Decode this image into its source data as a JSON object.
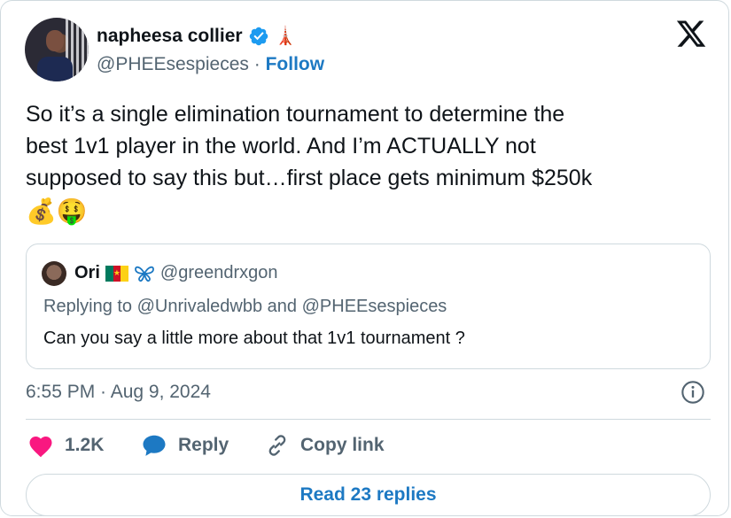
{
  "author": {
    "display_name": "napheesa collier",
    "handle": "@PHEEsespieces",
    "separator": "·",
    "follow_label": "Follow",
    "badge_emoji": "🗼"
  },
  "tweet": {
    "text": "So it’s a single elimination tournament to determine the\nbest 1v1 player in the world. And I’m ACTUALLY not\nsupposed to say this but…first place gets minimum $250k",
    "emojis": "💰🤑",
    "timestamp": "6:55 PM · Aug 9, 2024"
  },
  "quoted_tweet": {
    "display_name": "Ori",
    "handle": "@greendrxgon",
    "replying_prefix": "Replying to",
    "reply_to_1": "@Unrivaledwbb",
    "reply_conj": "and",
    "reply_to_2": "@PHEEsespieces",
    "text": "Can you say a little more about that 1v1 tournament ?"
  },
  "actions": {
    "like_count": "1.2K",
    "reply_label": "Reply",
    "copy_label": "Copy link"
  },
  "footer": {
    "read_replies_label": "Read 23 replies"
  },
  "colors": {
    "accent": "#1d79c3",
    "verified": "#1d9bf0",
    "like": "#f91880",
    "text_secondary": "#536471",
    "border": "#cfd9de"
  },
  "icons": {
    "platform": "x-logo-icon",
    "verified": "verified-badge-icon",
    "like": "heart-icon",
    "reply": "speech-bubble-icon",
    "copy": "link-icon",
    "info": "info-icon"
  }
}
